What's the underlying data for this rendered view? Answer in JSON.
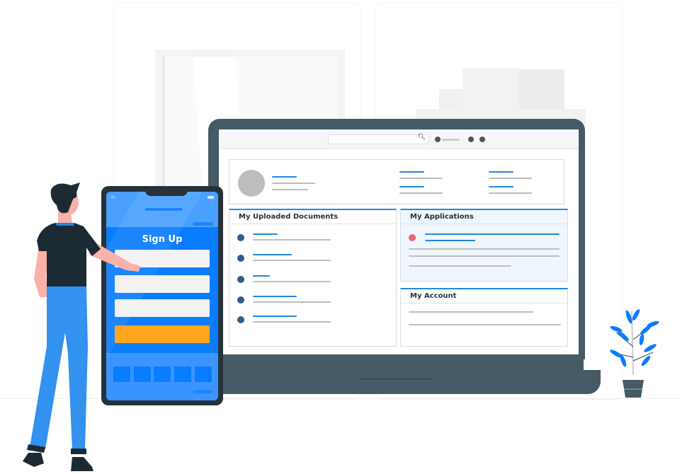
{
  "phone": {
    "title": "Sign Up",
    "fields": [
      "",
      "",
      ""
    ],
    "submit_color": "#FFA61F",
    "screen_color": "#0A7CFF"
  },
  "laptop": {
    "dashboard": {
      "uploaded_documents": {
        "title": "My Uploaded Documents",
        "item_count": 5
      },
      "applications": {
        "title": "My Applications",
        "status_color": "#F06373"
      },
      "account": {
        "title": "My Account"
      }
    }
  },
  "colors": {
    "accent": "#1E88E5",
    "device": "#455A64",
    "plant": "#0A7CFF"
  }
}
